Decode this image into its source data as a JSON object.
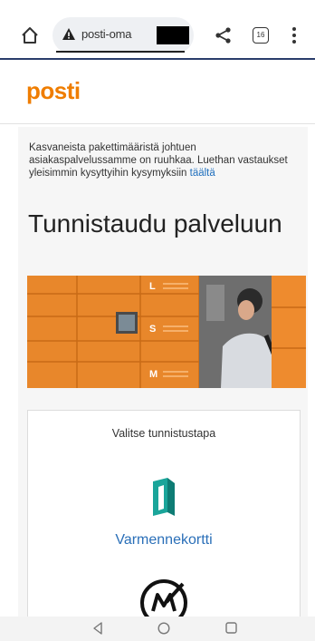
{
  "browser": {
    "url_text": "posti-oma",
    "tab_count": "16",
    "icons": [
      "home-icon",
      "warning-icon",
      "share-icon",
      "tabs-icon",
      "more-vert-icon"
    ]
  },
  "site": {
    "logo_text": "posti",
    "brand_color": "#ef7d00"
  },
  "notice": {
    "text": "Kasvaneista pakettimääristä johtuen asiakaspalvelussamme on ruuhkaa. Luethan vastaukset yleisimmin kysyttyihin kysymyksiin ",
    "link_text": "täältä"
  },
  "page": {
    "title": "Tunnistaudu palveluun"
  },
  "hero": {
    "locker_labels": [
      "L",
      "S",
      "M"
    ]
  },
  "auth_card": {
    "title": "Valitse tunnistustapa",
    "options": [
      {
        "label": "Varmennekortti",
        "icon": "varmennekortti-icon"
      },
      {
        "label": "",
        "icon": "mobiilivarmenne-icon"
      }
    ]
  },
  "android_nav": {
    "icons": [
      "back-icon",
      "home-circle-icon",
      "recents-icon"
    ]
  }
}
